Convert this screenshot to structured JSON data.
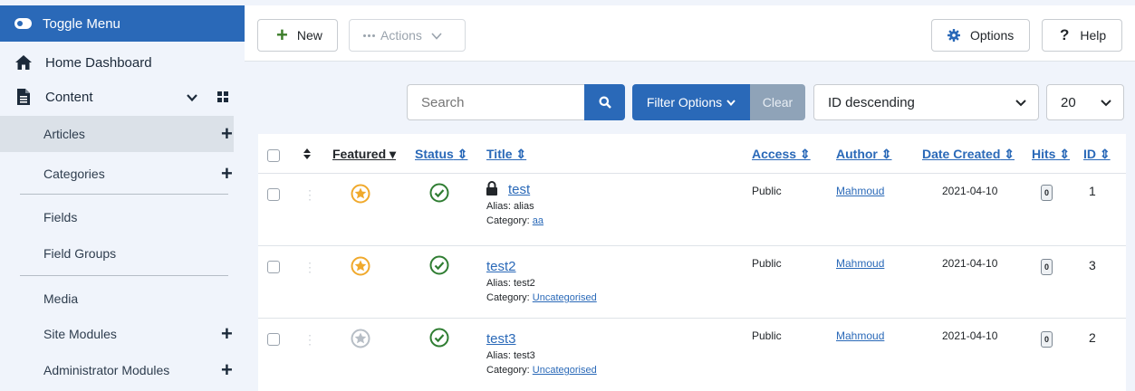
{
  "sidebar": {
    "toggle_label": "Toggle Menu",
    "home_label": "Home Dashboard",
    "content_label": "Content",
    "items": [
      {
        "label": "Articles",
        "has_add": true,
        "active": true
      },
      {
        "label": "Categories",
        "has_add": true
      },
      {
        "label": "Fields",
        "has_add": false
      },
      {
        "label": "Field Groups",
        "has_add": false
      },
      {
        "label": "Media",
        "has_add": false
      },
      {
        "label": "Site Modules",
        "has_add": true
      },
      {
        "label": "Administrator Modules",
        "has_add": true
      }
    ],
    "add_glyph": "+"
  },
  "toolbar": {
    "new_label": "New",
    "new_glyph": "+",
    "actions_label": "Actions",
    "options_label": "Options",
    "help_label": "Help",
    "help_glyph": "?"
  },
  "filters": {
    "search_placeholder": "Search",
    "filter_options_label": "Filter Options",
    "clear_label": "Clear",
    "sort_value": "ID descending",
    "limit_value": "20"
  },
  "table": {
    "columns": {
      "featured": "Featured",
      "status": "Status",
      "title": "Title",
      "access": "Access",
      "author": "Author",
      "date_created": "Date Created",
      "hits": "Hits",
      "id": "ID"
    },
    "rows": [
      {
        "title": "test",
        "locked": true,
        "featured": true,
        "alias": "Alias: alias",
        "category_prefix": "Category:",
        "category": "aa",
        "access": "Public",
        "author": "Mahmoud",
        "date": "2021-04-10",
        "hits": "0",
        "id": "1"
      },
      {
        "title": "test2",
        "locked": false,
        "featured": true,
        "alias": "Alias: test2",
        "category_prefix": "Category:",
        "category": "Uncategorised",
        "access": "Public",
        "author": "Mahmoud",
        "date": "2021-04-10",
        "hits": "0",
        "id": "3"
      },
      {
        "title": "test3",
        "locked": false,
        "featured": false,
        "alias": "Alias: test3",
        "category_prefix": "Category:",
        "category": "Uncategorised",
        "access": "Public",
        "author": "Mahmoud",
        "date": "2021-04-10",
        "hits": "0",
        "id": "2"
      }
    ]
  },
  "colors": {
    "primary": "#2a69b8",
    "featured": "#f0a92c",
    "published": "#2f7d32",
    "clear_bg": "#8fa3b8"
  }
}
